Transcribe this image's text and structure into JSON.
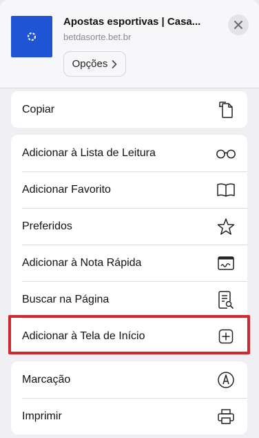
{
  "header": {
    "title": "Apostas esportivas | Casa...",
    "domain": "betdasorte.bet.br",
    "options_label": "Opções"
  },
  "groups": [
    {
      "items": [
        {
          "label": "Copiar",
          "icon": "copy-icon"
        }
      ]
    },
    {
      "items": [
        {
          "label": "Adicionar à Lista de Leitura",
          "icon": "glasses-icon"
        },
        {
          "label": "Adicionar Favorito",
          "icon": "book-icon"
        },
        {
          "label": "Preferidos",
          "icon": "star-icon"
        },
        {
          "label": "Adicionar à Nota Rápida",
          "icon": "quick-note-icon"
        },
        {
          "label": "Buscar na Página",
          "icon": "find-in-page-icon"
        },
        {
          "label": "Adicionar à Tela de Início",
          "icon": "add-square-icon"
        }
      ]
    },
    {
      "items": [
        {
          "label": "Marcação",
          "icon": "markup-icon"
        },
        {
          "label": "Imprimir",
          "icon": "printer-icon"
        }
      ]
    }
  ],
  "highlight_color": "#d0282d"
}
